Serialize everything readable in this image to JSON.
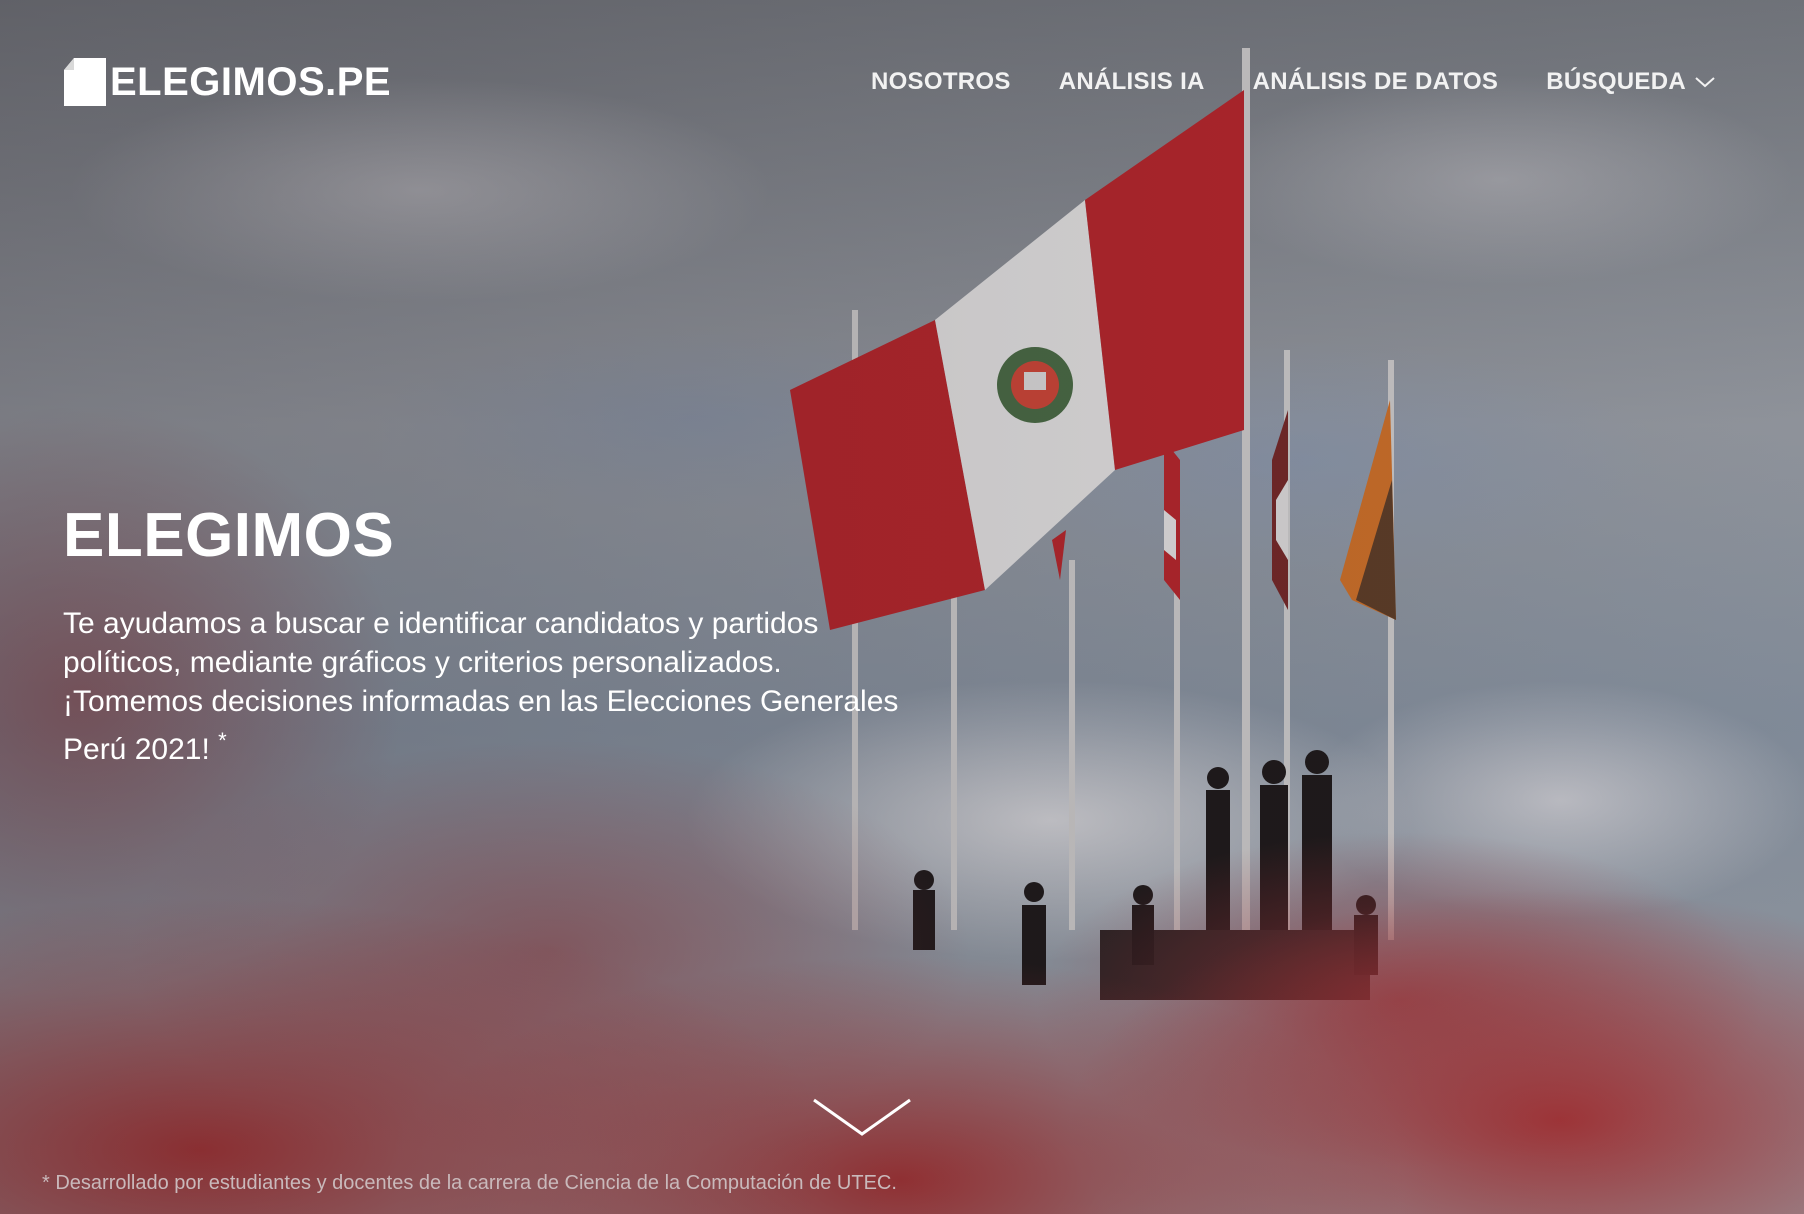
{
  "header": {
    "logo_text": "ELEGIMOS.PE",
    "nav": [
      {
        "label": "NOSOTROS"
      },
      {
        "label": "ANÁLISIS IA"
      },
      {
        "label": "ANÁLISIS DE DATOS"
      },
      {
        "label": "BÚSQUEDA",
        "icon": "chevron-down-icon"
      }
    ]
  },
  "hero": {
    "title": "ELEGIMOS",
    "description": "Te ayudamos a buscar e identificar candidatos y partidos políticos, mediante gráficos y criterios personalizados. ¡Tomemos decisiones informadas en las Elecciones Generales Perú 2021!",
    "asterisk": "*",
    "scroll_icon": "chevron-down-icon"
  },
  "footer": {
    "note": "* Desarrollado por estudiantes y docentes de la carrera de Ciencia de la Computación de UTEC."
  },
  "colors": {
    "flag_red": "#c0272d",
    "smoke_red": "#b03234",
    "text": "#ffffff"
  }
}
